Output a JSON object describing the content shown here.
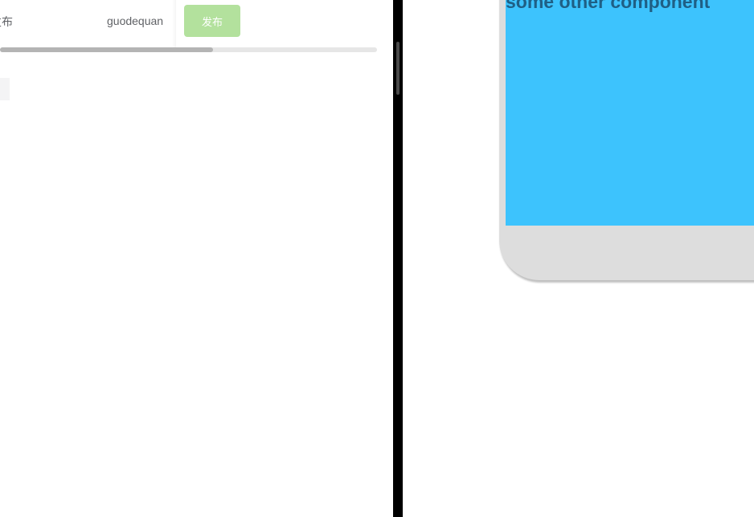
{
  "table": {
    "row": {
      "status": "发布",
      "author": "guodequan",
      "publish_button": "发布"
    },
    "h_scroll_progress": 0.565
  },
  "preview": {
    "screen_text": "some other component",
    "screen_color": "#3dc3fd",
    "frame_color": "#dddddd"
  },
  "colors": {
    "button_disabled_green": "#b3e19d",
    "text_gray": "#606266",
    "divider": "#000000"
  }
}
